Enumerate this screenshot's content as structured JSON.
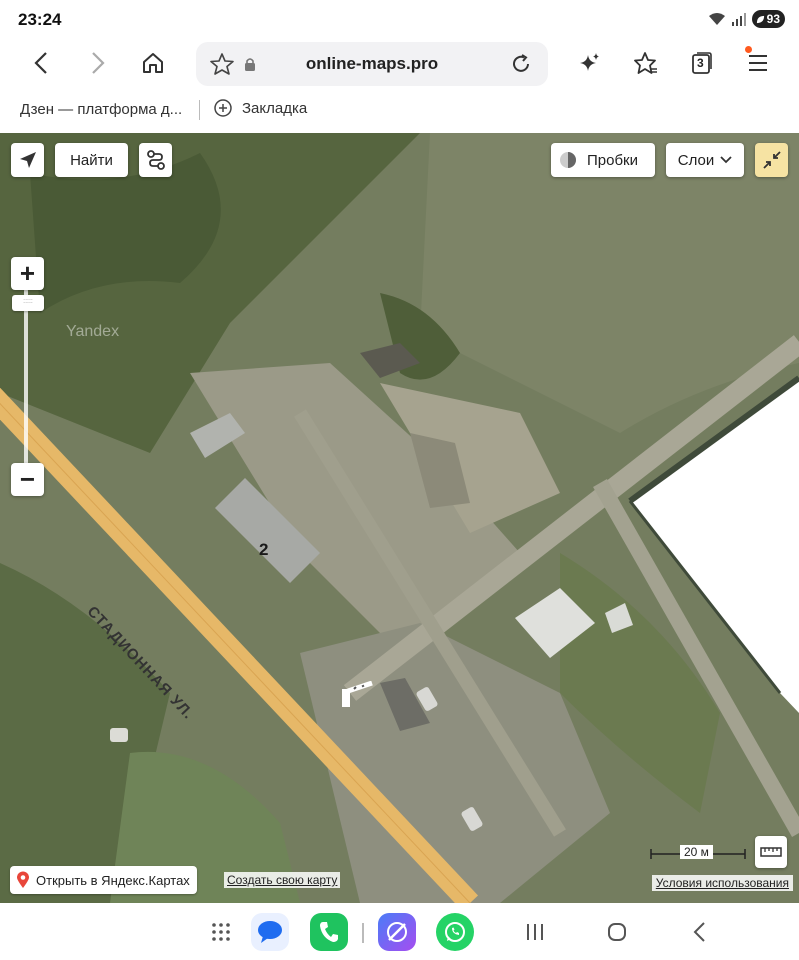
{
  "status_bar": {
    "time": "23:24",
    "battery": "93"
  },
  "browser": {
    "url": "online-maps.pro",
    "tab_count": "3"
  },
  "bookmarks": {
    "item1": "Дзен — платформа д...",
    "item2": "Закладка"
  },
  "map": {
    "find_button": "Найти",
    "traffic_button": "Пробки",
    "layers_button": "Слои",
    "road_label": "СТАДИОННАЯ УЛ.",
    "house_number": "2",
    "watermark": "Yandex",
    "open_in_yandex": "Открыть в Яндекс.Картах",
    "create_map": "Создать свою карту",
    "terms": "Условия использования",
    "scale": "20 м",
    "zoom_in": "+",
    "zoom_out": "−"
  },
  "colors": {
    "accent": "#ff5a1f",
    "map_pin": "#e8463a",
    "road": "#e6b868",
    "fullscreen_btn": "#f6e3a3"
  },
  "icons": {
    "nav": [
      "back-icon",
      "forward-icon",
      "home-icon"
    ],
    "url_bar": [
      "star-icon",
      "lock-icon",
      "reload-icon"
    ],
    "toolbar": [
      "sparkle-icon",
      "favorites-icon",
      "tabs-icon",
      "menu-icon"
    ],
    "map": [
      "locate-icon",
      "route-icon",
      "traffic-icon",
      "chevron-down-icon",
      "collapse-icon",
      "ruler-icon",
      "map-pin-icon",
      "barrier-icon"
    ],
    "dock": [
      "apps-icon",
      "messages-icon",
      "phone-icon",
      "browser-icon",
      "whatsapp-icon",
      "recents-icon",
      "home-button-icon",
      "back-nav-icon"
    ]
  }
}
